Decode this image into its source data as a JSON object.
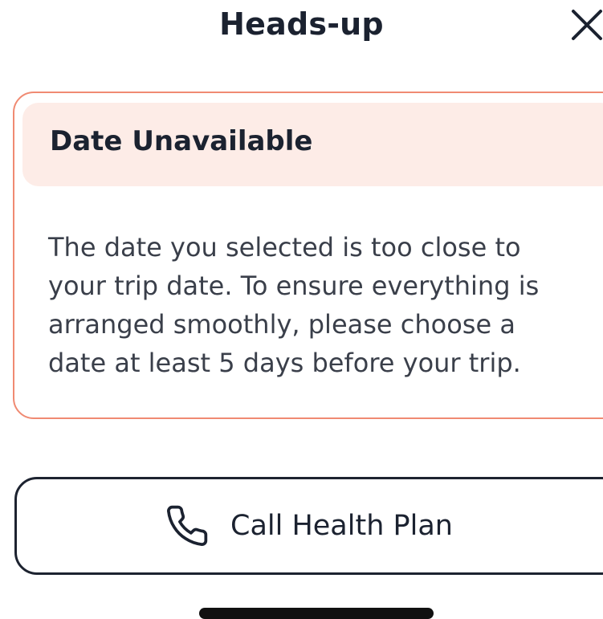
{
  "header": {
    "title": "Heads-up",
    "close_icon": "close-icon"
  },
  "alert": {
    "title": "Date Unavailable",
    "body": "The date you selected is too close to your trip date. To ensure everything is arranged smoothly, please choose a date at least 5 days before your trip.",
    "border_color": "#f08a72",
    "title_background": "#fdece7"
  },
  "call_button": {
    "label": "Call Health Plan",
    "icon": "phone-icon"
  }
}
